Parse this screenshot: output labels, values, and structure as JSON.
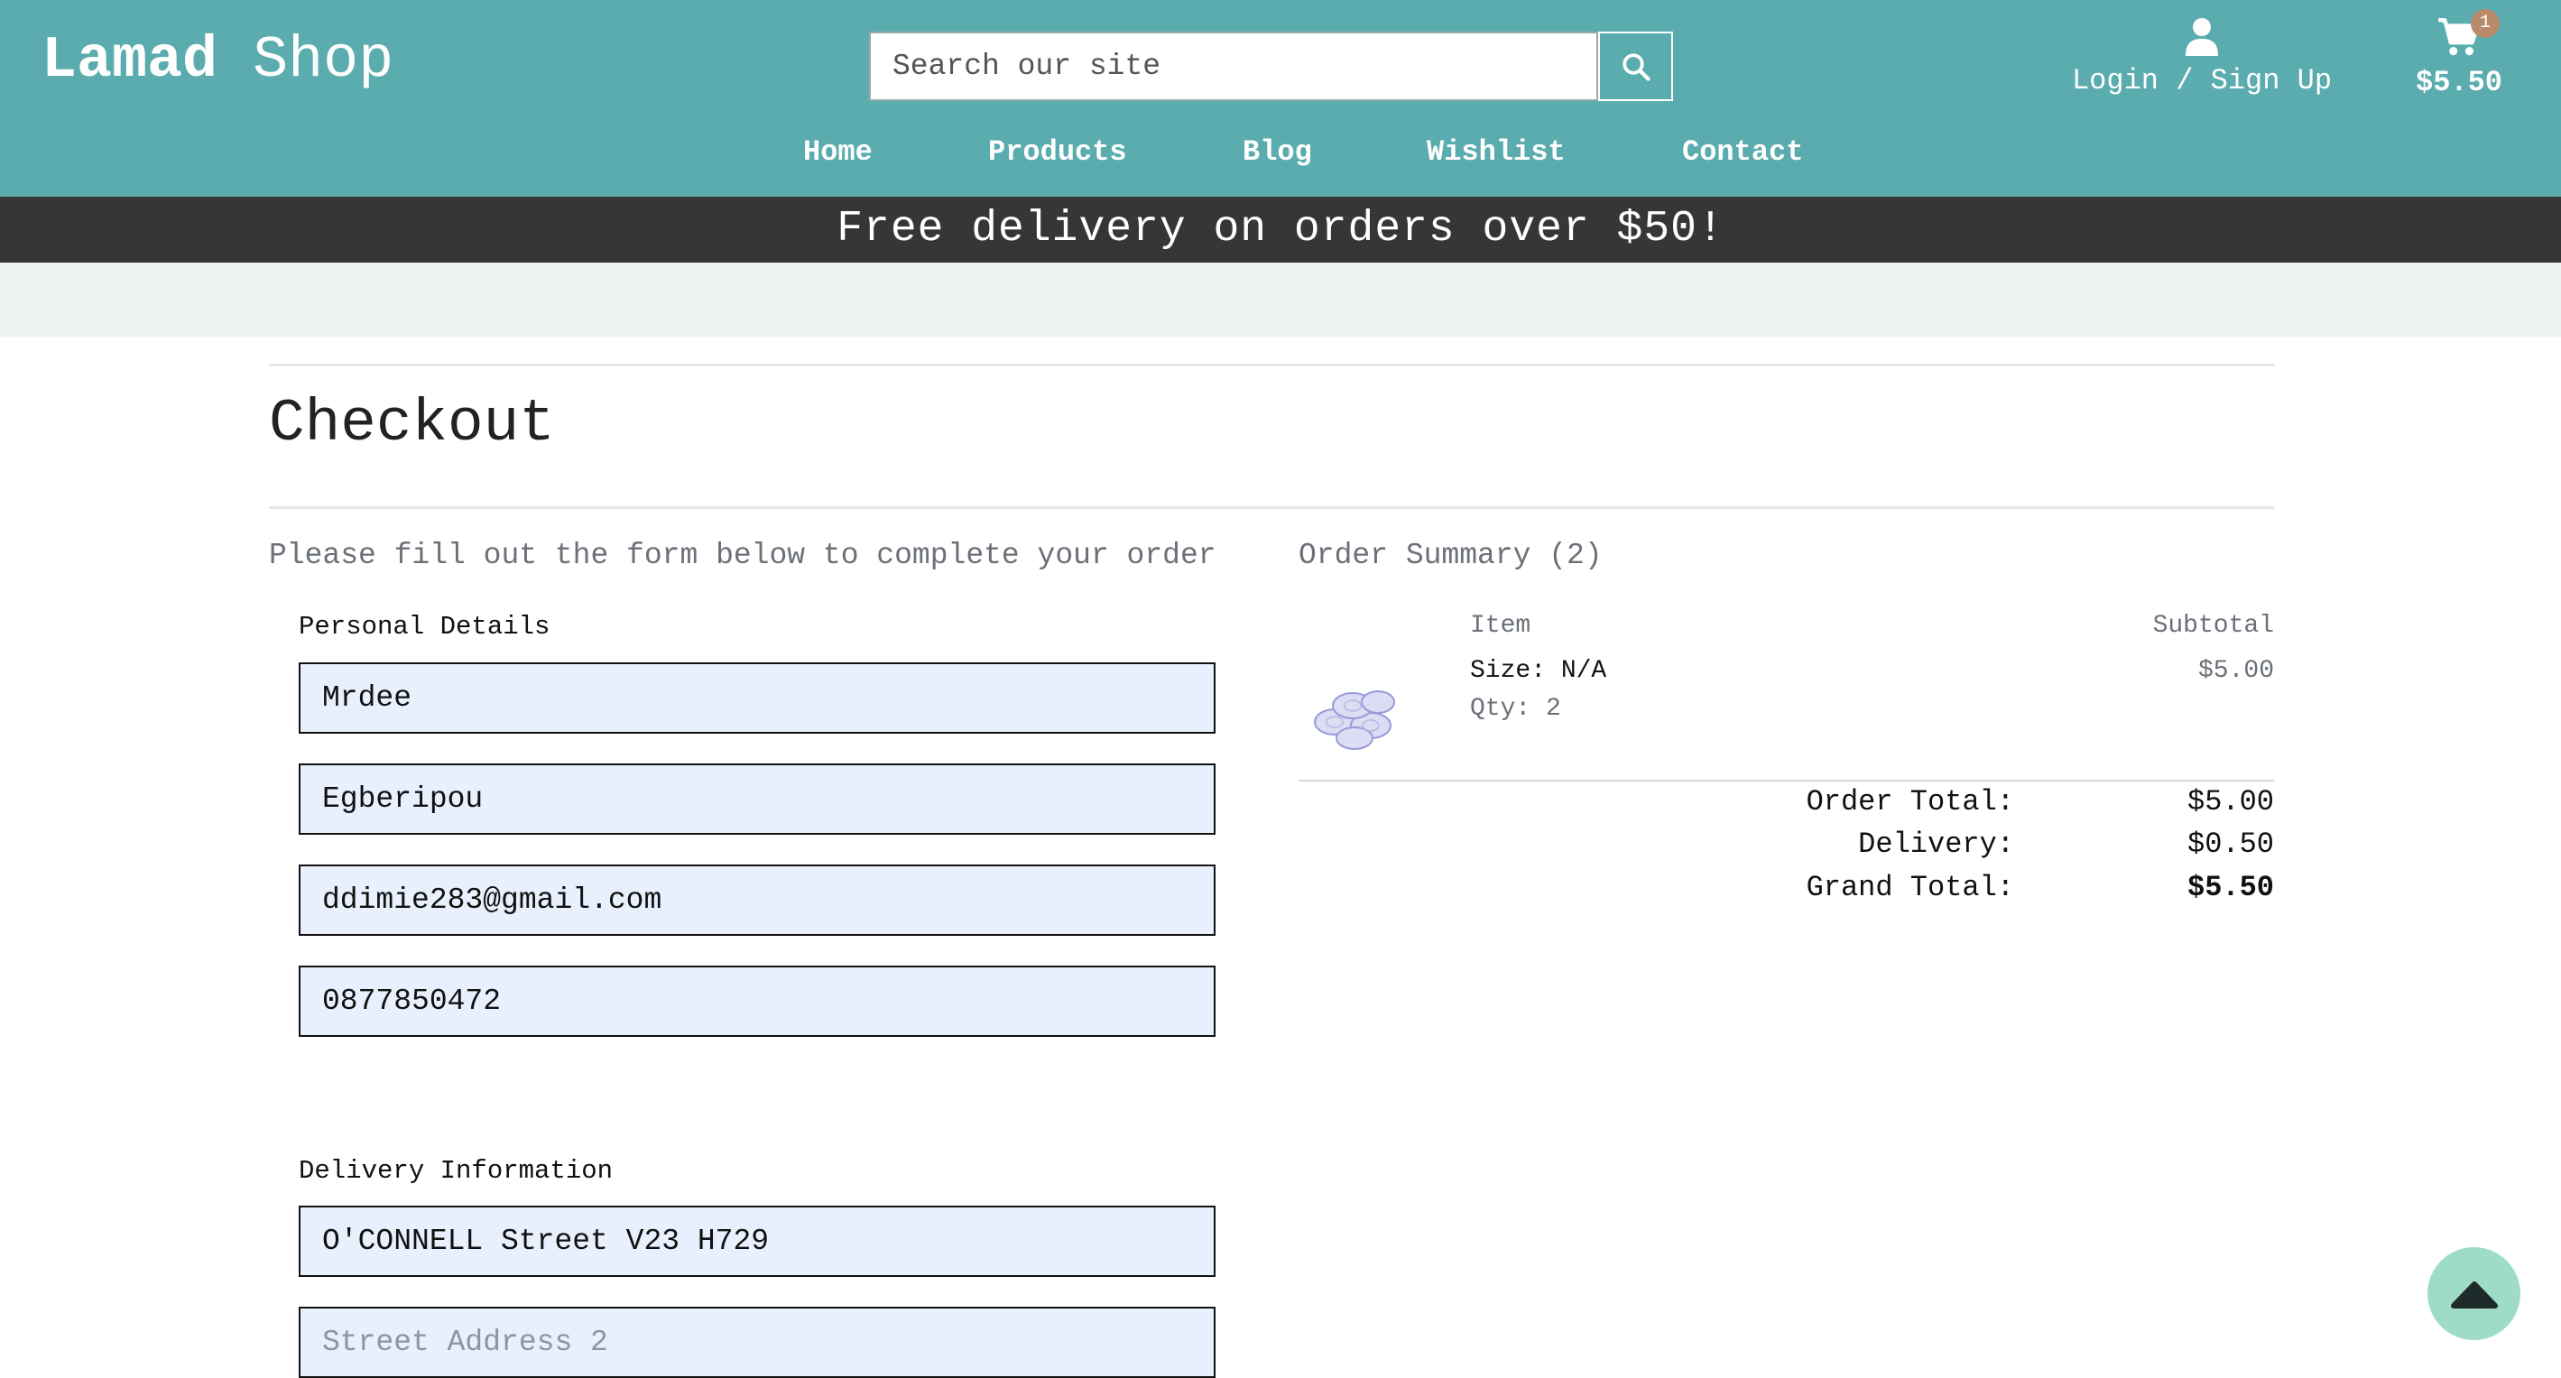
{
  "brand": {
    "part1": "Lamad",
    "part2": "Shop"
  },
  "search": {
    "placeholder": "Search our site",
    "icon": "search-icon"
  },
  "account": {
    "label": "Login / Sign Up",
    "icon": "user-icon"
  },
  "cart": {
    "count": "1",
    "total": "$5.50",
    "icon": "cart-icon"
  },
  "nav": [
    {
      "label": "Home"
    },
    {
      "label": "Products"
    },
    {
      "label": "Blog"
    },
    {
      "label": "Wishlist"
    },
    {
      "label": "Contact"
    }
  ],
  "promo": "Free delivery on orders over $50!",
  "checkout": {
    "title": "Checkout",
    "intro": "Please fill out the form below to complete your order",
    "personal": {
      "label": "Personal Details",
      "first_name": "Mrdee",
      "last_name": "Egberipou",
      "email": "ddimie283@gmail.com",
      "phone": "0877850472"
    },
    "delivery": {
      "label": "Delivery Information",
      "street1": "O'CONNELL Street V23 H729",
      "street2_placeholder": "Street Address 2"
    }
  },
  "summary": {
    "title": "Order Summary (2)",
    "col_item": "Item",
    "col_subtotal": "Subtotal",
    "item": {
      "size": "Size: N/A",
      "qty": "Qty: 2",
      "subtotal": "$5.00"
    },
    "order_total_label": "Order Total:",
    "order_total": "$5.00",
    "delivery_label": "Delivery:",
    "delivery": "$0.50",
    "grand_total_label": "Grand Total:",
    "grand_total": "$5.50"
  },
  "colors": {
    "header": "#5aacae",
    "promo_bar": "#363636",
    "field_bg": "#e8f0fe",
    "scroll_button": "#9fdcc8"
  }
}
